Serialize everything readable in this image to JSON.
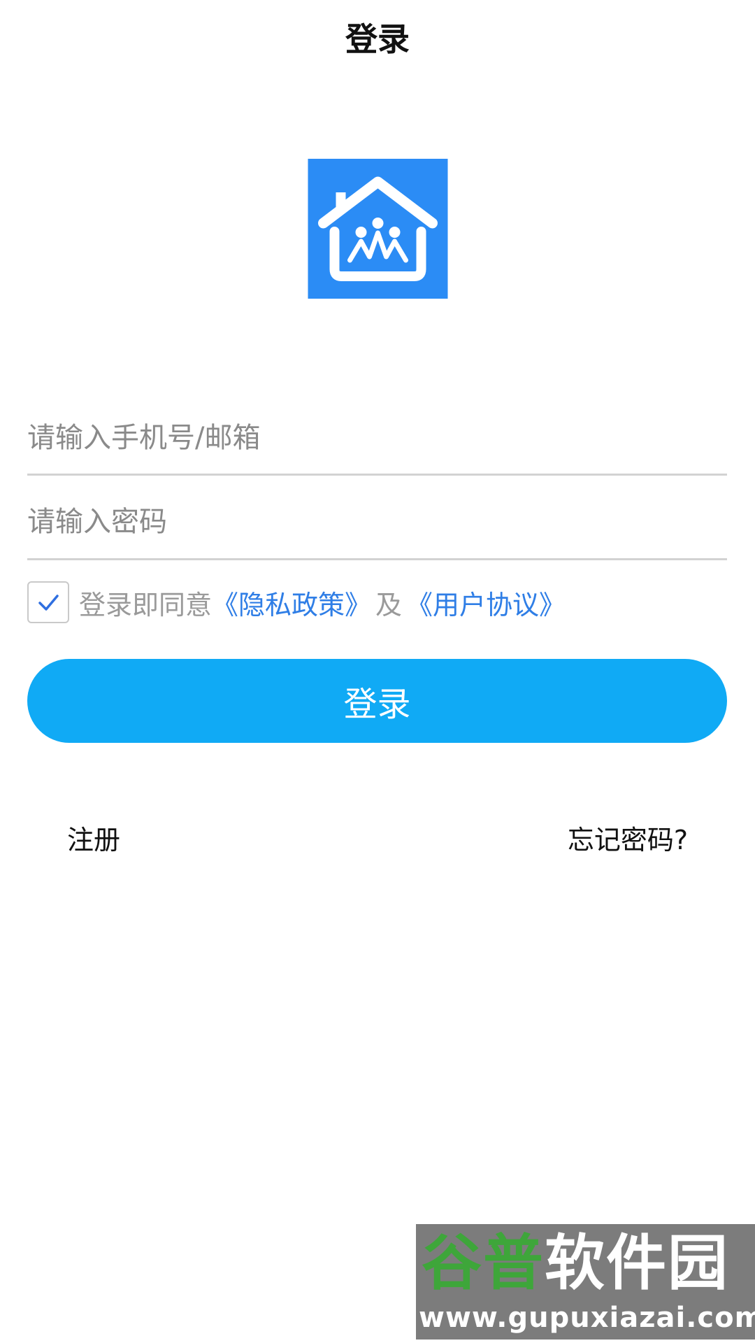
{
  "header": {
    "title": "登录"
  },
  "logo": {
    "icon": "house-family-icon",
    "background_color": "#2b8cf5"
  },
  "form": {
    "phone_placeholder": "请输入手机号/邮箱",
    "password_placeholder": "请输入密码",
    "agreement": {
      "checked": true,
      "prefix": "登录即同意",
      "privacy_link": "《隐私政策》",
      "and": "及",
      "terms_link": "《用户协议》"
    },
    "login_button": "登录"
  },
  "links": {
    "register": "注册",
    "forgot_password": "忘记密码?"
  },
  "watermark": {
    "brand_part1": "谷普",
    "brand_part2": "软件园",
    "url": "www.gupuxiazai.com"
  },
  "colors": {
    "accent": "#10aaf5",
    "link": "#2f7ee6",
    "logo_bg": "#2b8cf5"
  }
}
